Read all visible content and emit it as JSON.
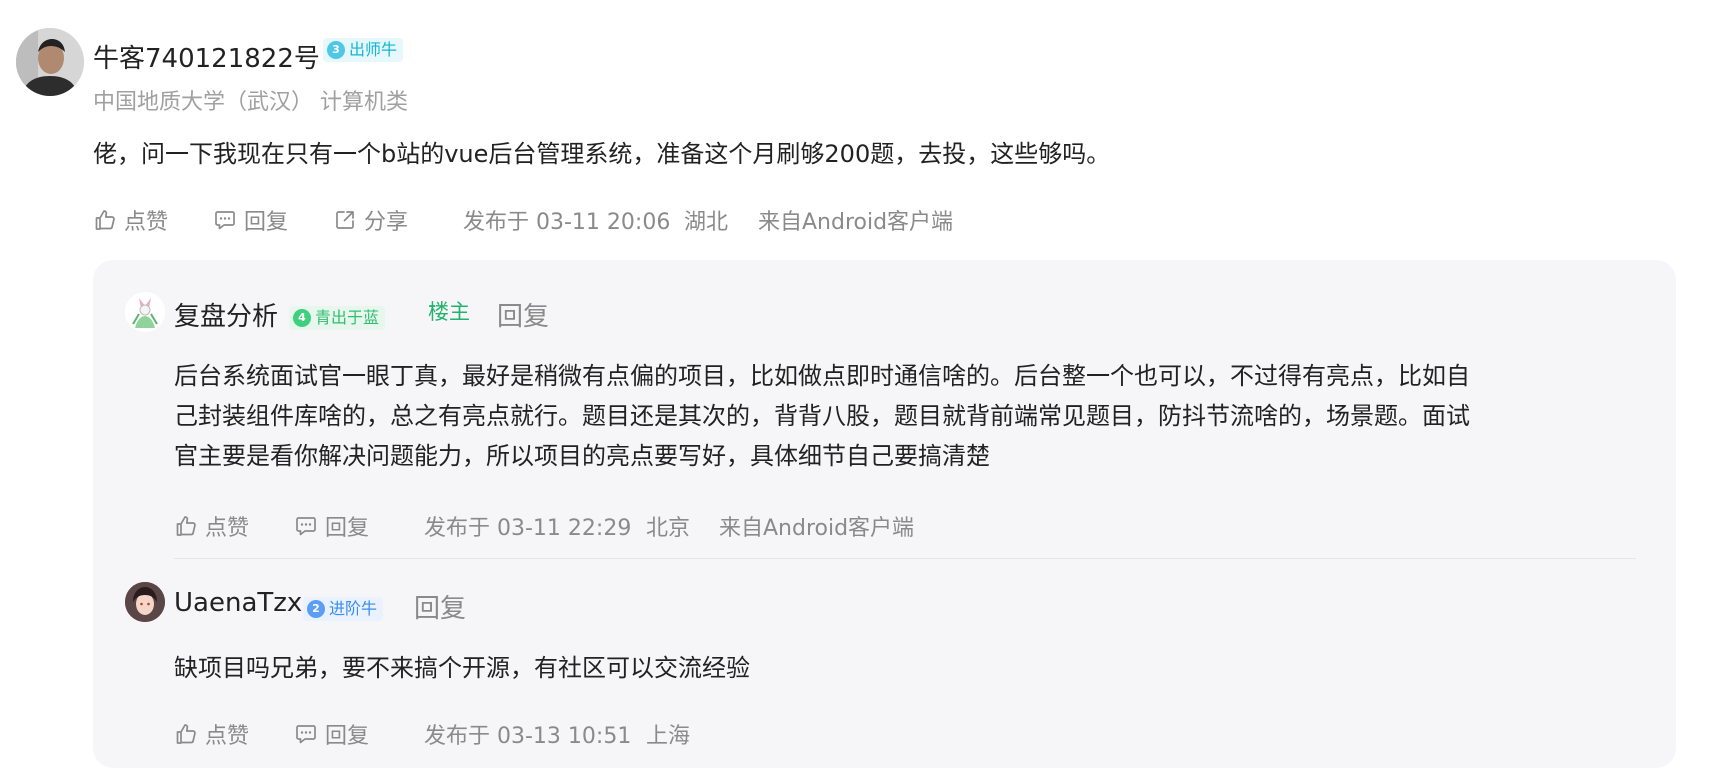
{
  "comment": {
    "author": "牛客740121822号",
    "badge": {
      "level": "3",
      "label": "出师牛",
      "color": "#13b5d6"
    },
    "school": "中国地质大学（武汉） 计算机类",
    "content": "佬，问一下我现在只有一个b站的vue后台管理系统，准备这个月刷够200题，去投，这些够吗。",
    "actions": {
      "like": "点赞",
      "reply": "回复",
      "share": "分享"
    },
    "published": "发布于 03-11 20:06",
    "location": "湖北",
    "client": "来自Android客户端"
  },
  "replies": [
    {
      "author": "复盘分析",
      "badge": {
        "level": "4",
        "label": "青出于蓝",
        "color": "#2fbf6f"
      },
      "owner_tag": "楼主",
      "reply_label": "回复",
      "content_lines": [
        "后台系统面试官一眼丁真，最好是稍微有点偏的项目，比如做点即时通信啥的。后台整一个也可以，不过得有亮点，比如自",
        "己封装组件库啥的，总之有亮点就行。题目还是其次的，背背八股，题目就背前端常见题目，防抖节流啥的，场景题。面试",
        "官主要是看你解决问题能力，所以项目的亮点要写好，具体细节自己要搞清楚"
      ],
      "actions": {
        "like": "点赞",
        "reply": "回复"
      },
      "published": "发布于 03-11 22:29",
      "location": "北京",
      "client": "来自Android客户端"
    },
    {
      "author": "UaenaTzx",
      "badge": {
        "level": "2",
        "label": "进阶牛",
        "color": "#3b8cf0"
      },
      "reply_label": "回复",
      "content": "缺项目吗兄弟，要不来搞个开源，有社区可以交流经验",
      "actions": {
        "like": "点赞",
        "reply": "回复"
      },
      "published": "发布于 03-13 10:51",
      "location": "上海"
    }
  ],
  "icons": [
    "thumbs-up-icon",
    "comment-icon",
    "share-icon"
  ]
}
